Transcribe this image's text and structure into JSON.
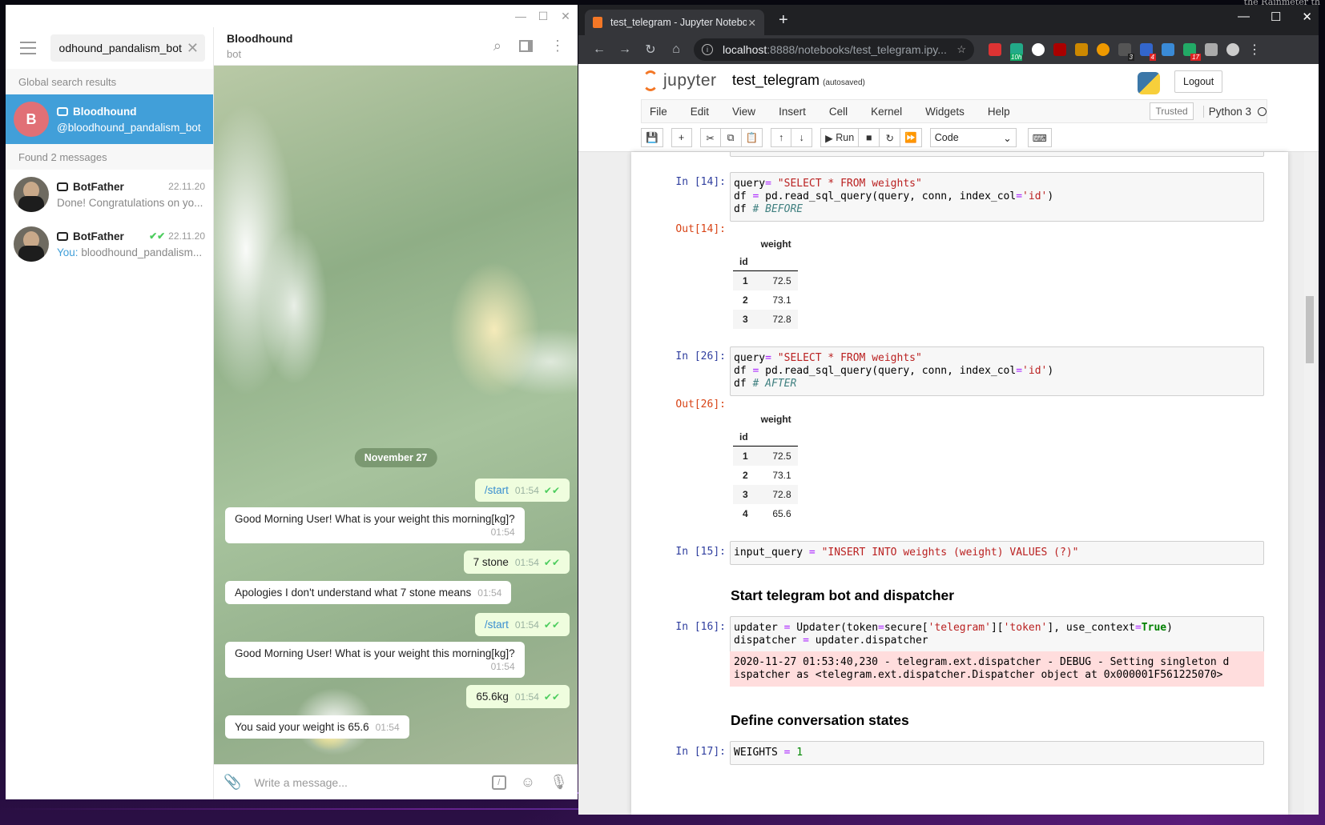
{
  "desktop": {
    "corner_text": "the Rainmeter th"
  },
  "telegram": {
    "search_query": "bloodhound_pandalism_bot",
    "global_header": "Global search results",
    "result": {
      "avatar_letter": "B",
      "name": "Bloodhound",
      "handle": "@bloodhound_pandalism_bot"
    },
    "found_header": "Found 2 messages",
    "messages_found": [
      {
        "name": "BotFather",
        "date": "22.11.20",
        "preview": "Done! Congratulations on yo...",
        "prefix": ""
      },
      {
        "name": "BotFather",
        "date": "22.11.20",
        "preview": "bloodhound_pandalism...",
        "prefix": "You:"
      }
    ],
    "chat": {
      "name": "Bloodhound",
      "status": "bot",
      "date_pill": "November 27",
      "messages": [
        {
          "dir": "out",
          "text": "/start",
          "time": "01:54"
        },
        {
          "dir": "in",
          "text": "Good Morning User! What is your weight this morning[kg]?",
          "time": "01:54"
        },
        {
          "dir": "out",
          "text": "7 stone",
          "time": "01:54"
        },
        {
          "dir": "in",
          "text": "Apologies I don't understand what 7 stone means",
          "time": "01:54"
        },
        {
          "dir": "out",
          "text": "/start",
          "time": "01:54"
        },
        {
          "dir": "in",
          "text": "Good Morning User! What is your weight this morning[kg]?",
          "time": "01:54"
        },
        {
          "dir": "out",
          "text": "65.6kg",
          "time": "01:54"
        },
        {
          "dir": "in",
          "text": "You said your weight is 65.6",
          "time": "01:54"
        }
      ],
      "composer_placeholder": "Write a message..."
    }
  },
  "chrome": {
    "tab_title": "test_telegram - Jupyter Notebook",
    "url_host": "localhost",
    "url_rest": ":8888/notebooks/test_telegram.ipy...",
    "ext_badges": [
      "10h",
      "3",
      "4",
      "17"
    ]
  },
  "jupyter": {
    "logo_word": "jupyter",
    "notebook_name": "test_telegram",
    "autosaved": "(autosaved)",
    "logout": "Logout",
    "menu": [
      "File",
      "Edit",
      "View",
      "Insert",
      "Cell",
      "Kernel",
      "Widgets",
      "Help"
    ],
    "trusted": "Trusted",
    "kernel": "Python 3",
    "run_label": "Run",
    "cell_type": "Code",
    "cells": {
      "in14": {
        "prompt": "In [14]:",
        "out_prompt": "Out[14]:"
      },
      "in26": {
        "prompt": "In [26]:",
        "out_prompt": "Out[26]:"
      },
      "in15": {
        "prompt": "In [15]:"
      },
      "in16": {
        "prompt": "In [16]:",
        "stderr": "2020-11-27 01:53:40,230 - telegram.ext.dispatcher - DEBUG - Setting singleton d\nispatcher as <telegram.ext.dispatcher.Dispatcher object at 0x000001F561225070>"
      },
      "in17": {
        "prompt": "In [17]:"
      }
    },
    "table14": {
      "col": "weight",
      "index": "id",
      "rows": [
        [
          "1",
          "72.5"
        ],
        [
          "2",
          "73.1"
        ],
        [
          "3",
          "72.8"
        ]
      ]
    },
    "table26": {
      "col": "weight",
      "index": "id",
      "rows": [
        [
          "1",
          "72.5"
        ],
        [
          "2",
          "73.1"
        ],
        [
          "3",
          "72.8"
        ],
        [
          "4",
          "65.6"
        ]
      ]
    },
    "md1": "Start telegram bot and dispatcher",
    "md2": "Define conversation states"
  }
}
